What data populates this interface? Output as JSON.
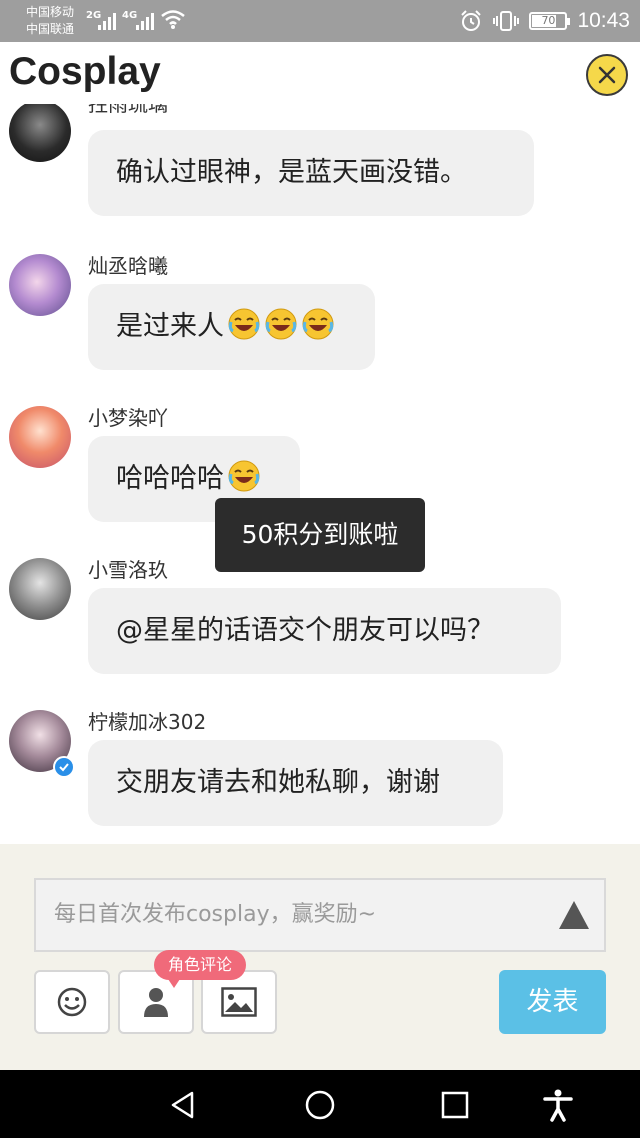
{
  "status_bar": {
    "carrier_1": "中国移动",
    "carrier_2": "中国联通",
    "network_1": "2G",
    "network_2": "4G",
    "battery": "70",
    "time": "10:43"
  },
  "header": {
    "title": "Cosplay",
    "close_icon": "close-icon"
  },
  "messages": [
    {
      "username": "拄雨琉璃",
      "text": "确认过眼神，是蓝天画没错。",
      "emoji_count": 0,
      "verified": false
    },
    {
      "username": "灿丞晗曦",
      "text": "是过来人",
      "emoji_count": 3,
      "verified": false
    },
    {
      "username": "小梦染吖",
      "text": "哈哈哈哈",
      "emoji_count": 1,
      "verified": false
    },
    {
      "username": "小雪洛玖",
      "text": "@星星的话语交个朋友可以吗？",
      "emoji_count": 0,
      "verified": false
    },
    {
      "username": "柠檬加冰302",
      "text": "交朋友请去和她私聊，谢谢",
      "emoji_count": 0,
      "verified": true
    }
  ],
  "toast": {
    "text": "50积分到账啦"
  },
  "composer": {
    "placeholder": "每日首次发布cosplay，赢奖励~",
    "role_badge": "角色评论",
    "publish_label": "发表",
    "tools": [
      "emoji-icon",
      "person-icon",
      "image-icon"
    ]
  },
  "colors": {
    "accent": "#5bc0e6",
    "badge": "#f06a7a",
    "close": "#f5d84a"
  }
}
